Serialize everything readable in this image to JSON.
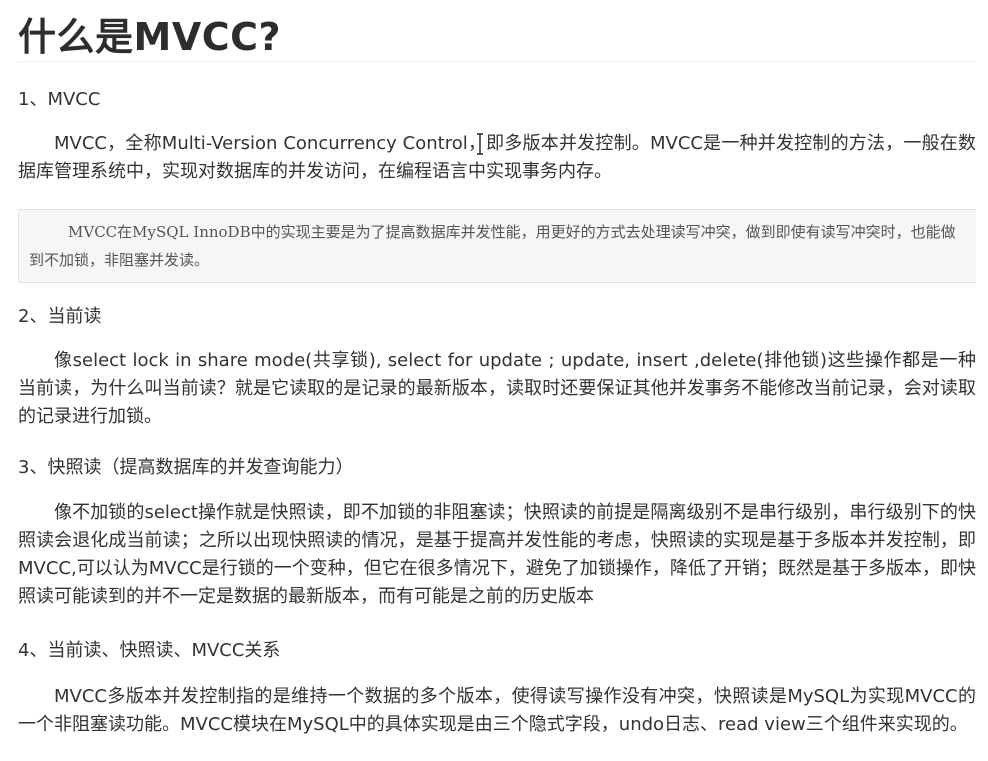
{
  "article": {
    "title": "什么是MVCC?",
    "sections": [
      {
        "heading": "1、MVCC",
        "paragraph": "MVCC，全称Multi-Version Concurrency Control，即多版本并发控制。MVCC是一种并发控制的方法，一般在数据库管理系统中，实现对数据库的并发访问，在编程语言中实现事务内存。",
        "quote": "MVCC在MySQL InnoDB中的实现主要是为了提高数据库并发性能，用更好的方式去处理读写冲突，做到即使有读写冲突时，也能做到不加锁，非阻塞并发读。"
      },
      {
        "heading": "2、当前读",
        "paragraph": "像select lock in share mode(共享锁), select for update ; update, insert ,delete(排他锁)这些操作都是一种当前读，为什么叫当前读？就是它读取的是记录的最新版本，读取时还要保证其他并发事务不能修改当前记录，会对读取的记录进行加锁。"
      },
      {
        "heading": "3、快照读（提高数据库的并发查询能力）",
        "paragraph": "像不加锁的select操作就是快照读，即不加锁的非阻塞读；快照读的前提是隔离级别不是串行级别，串行级别下的快照读会退化成当前读；之所以出现快照读的情况，是基于提高并发性能的考虑，快照读的实现是基于多版本并发控制，即MVCC,可以认为MVCC是行锁的一个变种，但它在很多情况下，避免了加锁操作，降低了开销；既然是基于多版本，即快照读可能读到的并不一定是数据的最新版本，而有可能是之前的历史版本"
      },
      {
        "heading": "4、当前读、快照读、MVCC关系",
        "paragraph": "MVCC多版本并发控制指的是维持一个数据的多个版本，使得读写操作没有冲突，快照读是MySQL为实现MVCC的一个非阻塞读功能。MVCC模块在MySQL中的具体实现是由三个隐式字段，undo日志、read view三个组件来实现的。"
      }
    ]
  },
  "colors": {
    "text": "#333333",
    "title": "#2d2d2d",
    "quote_background": "#f6f6f6",
    "quote_border": "#e3e3e3"
  },
  "icons": {
    "cursor": "text-cursor-icon"
  }
}
